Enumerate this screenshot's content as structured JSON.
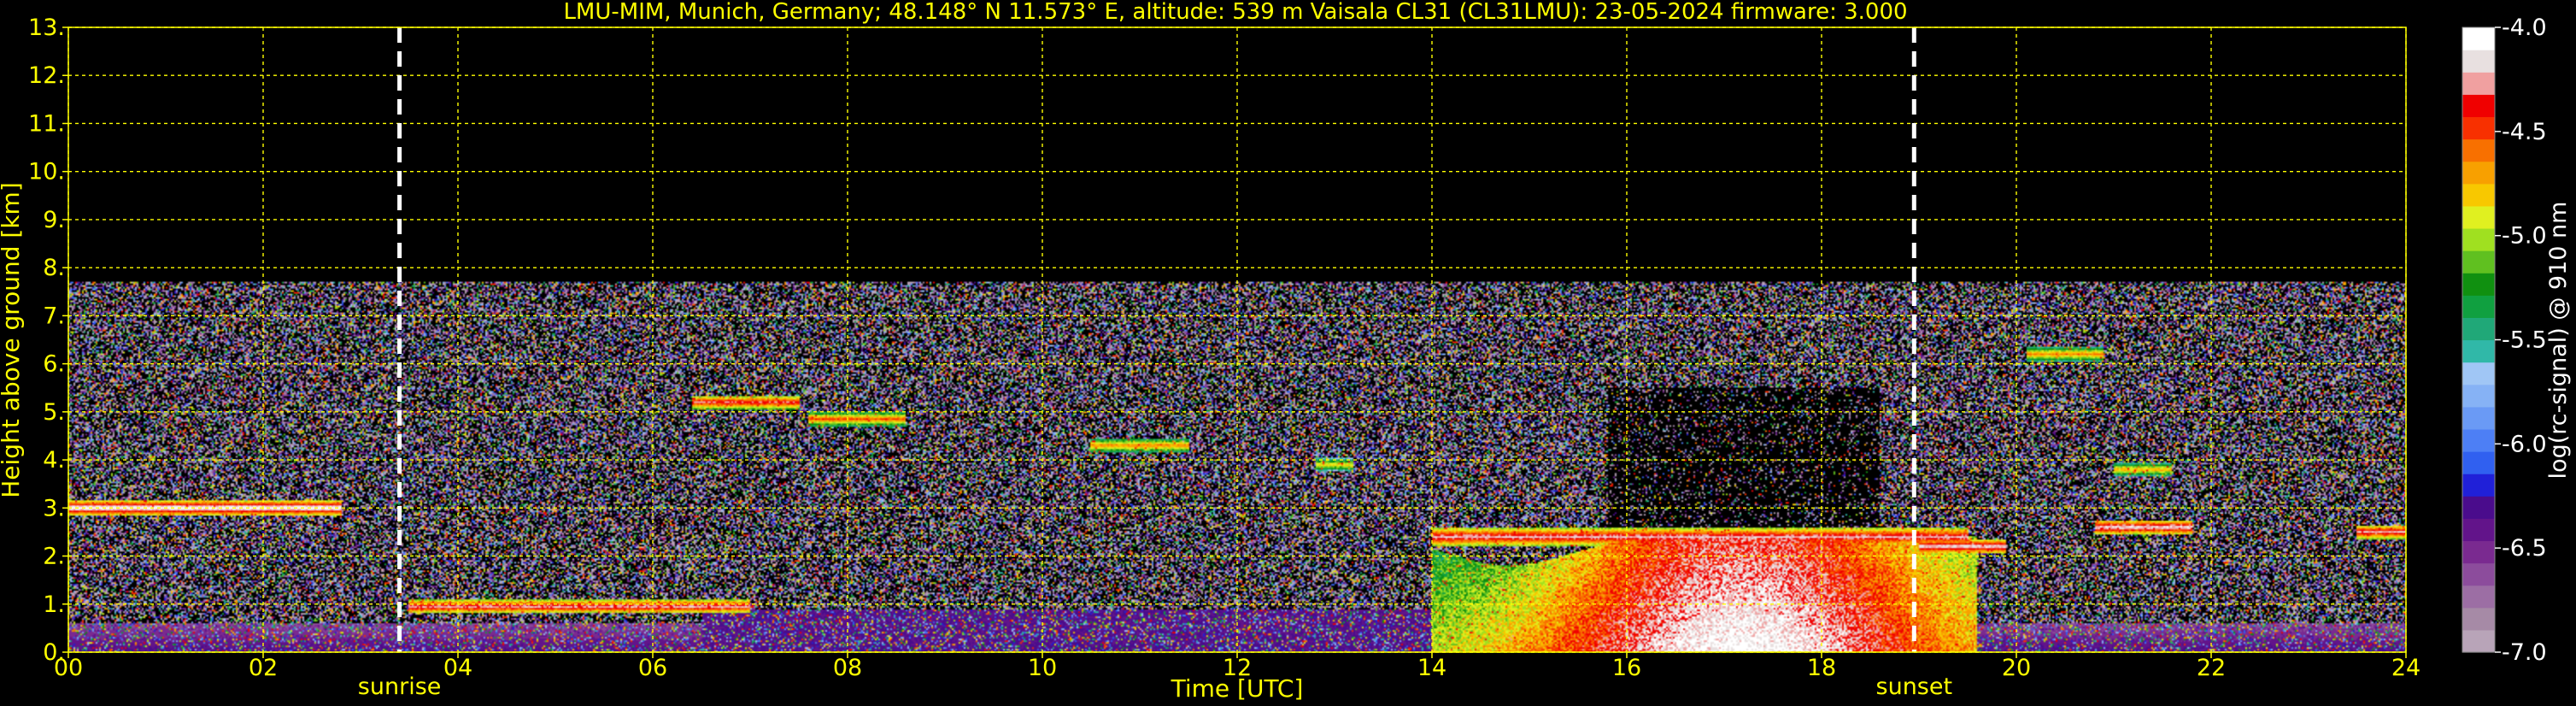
{
  "chart_data": {
    "type": "heatmap",
    "title": "LMU-MIM, Munich, Germany; 48.148° N 11.573° E, altitude: 539 m    Vaisala CL31 (CL31LMU): 23-05-2024    firmware: 3.000",
    "xlabel": "Time [UTC]",
    "ylabel": "Height above ground [km]",
    "xlim": [
      0,
      24
    ],
    "ylim": [
      0,
      13
    ],
    "x_ticks": [
      {
        "value": 0,
        "label": "00"
      },
      {
        "value": 2,
        "label": "02"
      },
      {
        "value": 4,
        "label": "04"
      },
      {
        "value": 6,
        "label": "06"
      },
      {
        "value": 8,
        "label": "08"
      },
      {
        "value": 10,
        "label": "10"
      },
      {
        "value": 12,
        "label": "12"
      },
      {
        "value": 14,
        "label": "14"
      },
      {
        "value": 16,
        "label": "16"
      },
      {
        "value": 18,
        "label": "18"
      },
      {
        "value": 20,
        "label": "20"
      },
      {
        "value": 22,
        "label": "22"
      },
      {
        "value": 24,
        "label": "24"
      }
    ],
    "y_ticks": [
      {
        "value": 0,
        "label": "0."
      },
      {
        "value": 1,
        "label": "1."
      },
      {
        "value": 2,
        "label": "2."
      },
      {
        "value": 3,
        "label": "3."
      },
      {
        "value": 4,
        "label": "4."
      },
      {
        "value": 5,
        "label": "5."
      },
      {
        "value": 6,
        "label": "6."
      },
      {
        "value": 7,
        "label": "7."
      },
      {
        "value": 8,
        "label": "8."
      },
      {
        "value": 9,
        "label": "9."
      },
      {
        "value": 10,
        "label": "10."
      },
      {
        "value": 11,
        "label": "11."
      },
      {
        "value": 12,
        "label": "12."
      },
      {
        "value": 13,
        "label": "13."
      }
    ],
    "grid": true,
    "grid_color": "#ffff00",
    "measurement_top_km": 7.7,
    "markers": [
      {
        "label": "sunrise",
        "x": 3.4
      },
      {
        "label": "sunset",
        "x": 18.95
      }
    ],
    "colorbar": {
      "label": "log(rc-signal) @ 910 nm",
      "range": [
        -7.0,
        -4.0
      ],
      "ticks": [
        {
          "value": -4.0,
          "label": "-4.0"
        },
        {
          "value": -4.5,
          "label": "-4.5"
        },
        {
          "value": -5.0,
          "label": "-5.0"
        },
        {
          "value": -5.5,
          "label": "-5.5"
        },
        {
          "value": -6.0,
          "label": "-6.0"
        },
        {
          "value": -6.5,
          "label": "-6.5"
        },
        {
          "value": -7.0,
          "label": "-7.0"
        }
      ],
      "colors": [
        "#b8a4b8",
        "#a68aa6",
        "#9c6ea4",
        "#8c4c9c",
        "#7a2a90",
        "#62148a",
        "#4a0c8c",
        "#2020d8",
        "#3060f0",
        "#4d7ff5",
        "#6a9af5",
        "#86b2f5",
        "#a0c6f5",
        "#30b8a8",
        "#20a878",
        "#10a040",
        "#109010",
        "#60c020",
        "#a0e020",
        "#e0f020",
        "#f8c800",
        "#f8a000",
        "#f87000",
        "#f83000",
        "#f00000",
        "#f0a0a0",
        "#e8e0e0",
        "#ffffff"
      ]
    },
    "features": [
      {
        "kind": "cloud_layer",
        "x_start": 0.0,
        "x_end": 2.8,
        "height_km": 3.0,
        "value": -4.0
      },
      {
        "kind": "aerosol_layer",
        "x_start": 3.5,
        "x_end": 7.0,
        "height_km": 0.95,
        "value": -4.2
      },
      {
        "kind": "cloud_layer",
        "x_start": 6.4,
        "x_end": 7.5,
        "height_km": 5.2,
        "value": -4.3
      },
      {
        "kind": "cloud_layer",
        "x_start": 7.6,
        "x_end": 8.6,
        "height_km": 4.85,
        "value": -4.5
      },
      {
        "kind": "cloud_patch",
        "x_start": 10.5,
        "x_end": 11.5,
        "height_km": 4.3,
        "value": -4.6
      },
      {
        "kind": "cloud_patch",
        "x_start": 12.8,
        "x_end": 13.2,
        "height_km": 3.9,
        "value": -4.8
      },
      {
        "kind": "boundary_layer",
        "x_start": 14.0,
        "x_end": 19.5,
        "height_km": 2.4,
        "value": -4.2
      },
      {
        "kind": "cloud_layer",
        "x_start": 19.0,
        "x_end": 19.9,
        "height_km": 2.2,
        "value": -4.1
      },
      {
        "kind": "cloud_patch",
        "x_start": 20.1,
        "x_end": 20.9,
        "height_km": 6.2,
        "value": -4.6
      },
      {
        "kind": "cloud_patch",
        "x_start": 21.0,
        "x_end": 21.6,
        "height_km": 3.8,
        "value": -4.7
      },
      {
        "kind": "cloud_layer",
        "x_start": 20.8,
        "x_end": 21.8,
        "height_km": 2.6,
        "value": -4.1
      },
      {
        "kind": "cloud_layer",
        "x_start": 23.5,
        "x_end": 24.0,
        "height_km": 2.5,
        "value": -4.2
      }
    ]
  }
}
